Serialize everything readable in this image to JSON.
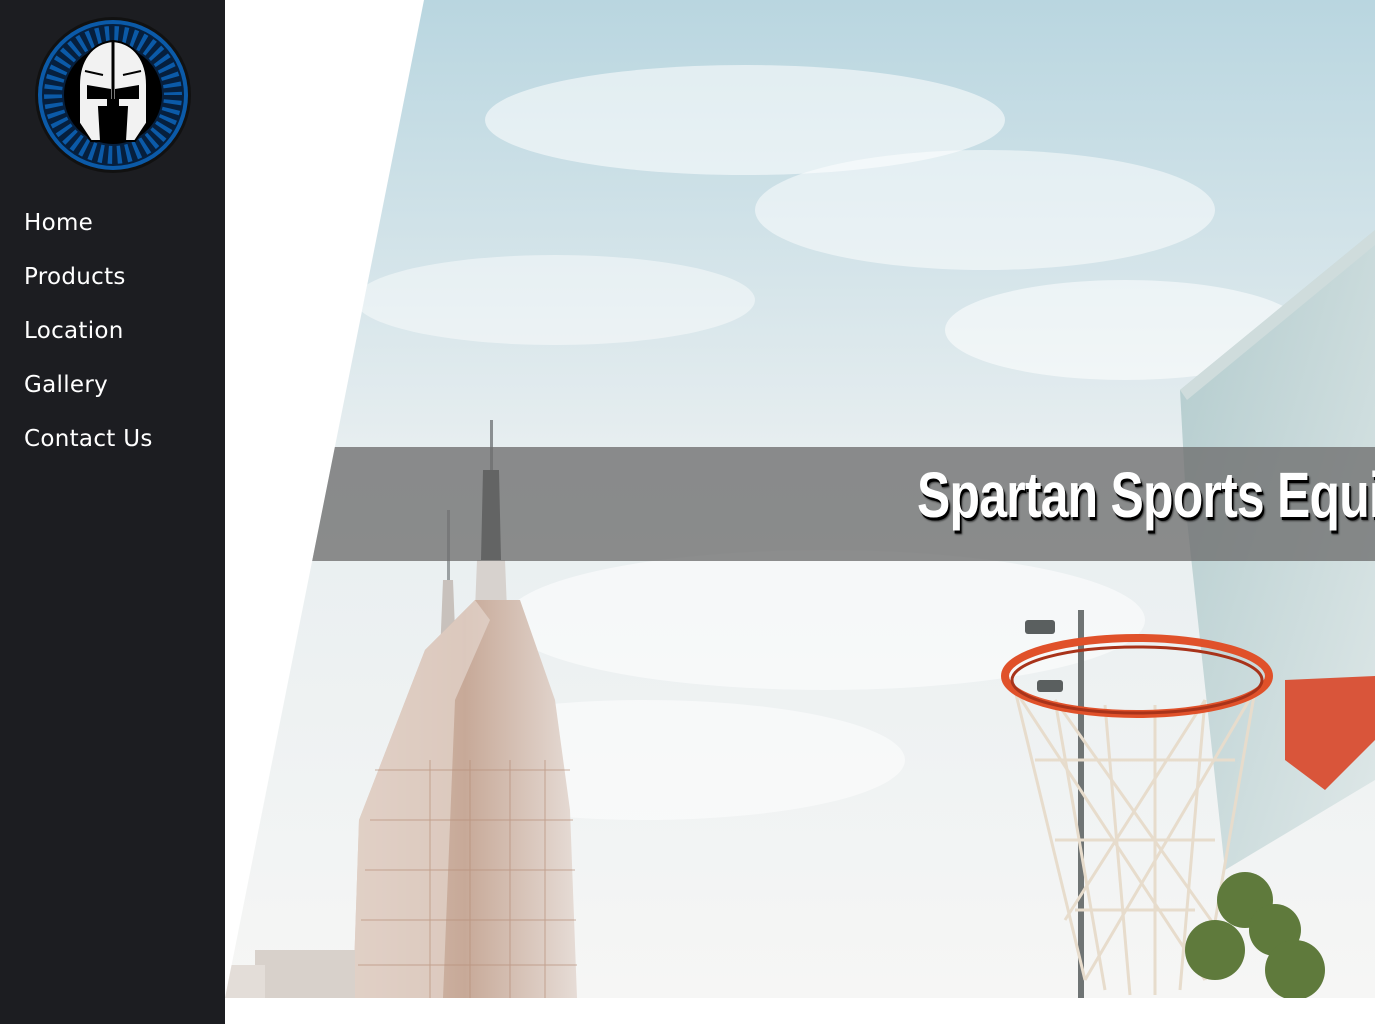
{
  "sidebar": {
    "logo_icon": "spartan-helmet-icon",
    "nav": [
      {
        "label": "Home"
      },
      {
        "label": "Products"
      },
      {
        "label": "Location"
      },
      {
        "label": "Gallery"
      },
      {
        "label": "Contact Us"
      }
    ]
  },
  "hero": {
    "title": "Spartan Sports Equi",
    "image_description_icon": "basketball-hoop-skyline-image"
  },
  "colors": {
    "sidebar_bg": "#1c1d21",
    "logo_ring": "#0b5aa8",
    "banner_overlay": "#6e6e6e",
    "rim": "#e0512a"
  }
}
